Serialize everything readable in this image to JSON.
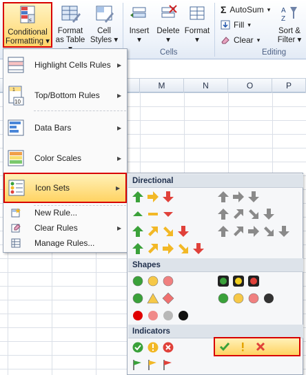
{
  "ribbon": {
    "conditional_formatting": {
      "line1": "Conditional",
      "line2": "Formatting"
    },
    "format_as_table": {
      "line1": "Format",
      "line2": "as Table"
    },
    "cell_styles": {
      "line1": "Cell",
      "line2": "Styles"
    },
    "insert": "Insert",
    "delete": "Delete",
    "format": "Format",
    "cells_group": "Cells",
    "autosum": "AutoSum",
    "fill": "Fill",
    "clear": "Clear",
    "sort_filter": {
      "line1": "Sort &",
      "line2": "Filter"
    },
    "editing_group": "Editing"
  },
  "columns": [
    "M",
    "N",
    "O",
    "P"
  ],
  "menu": {
    "items": [
      {
        "label": "Highlight Cells Rules",
        "icon": "highlight-cells-icon"
      },
      {
        "label": "Top/Bottom Rules",
        "icon": "top-bottom-icon"
      },
      {
        "label": "Data Bars",
        "icon": "data-bars-icon"
      },
      {
        "label": "Color Scales",
        "icon": "color-scales-icon"
      },
      {
        "label": "Icon Sets",
        "icon": "icon-sets-icon"
      }
    ],
    "new_rule": "New Rule...",
    "clear_rules": "Clear Rules",
    "manage_rules": "Manage Rules..."
  },
  "submenu": {
    "directional": "Directional",
    "shapes": "Shapes",
    "indicators": "Indicators"
  },
  "colors": {
    "highlight_border": "#d80000",
    "highlight_fill": "#ffd362",
    "green": "#3aa13a",
    "yellow": "#f2b826",
    "red": "#e0413a",
    "gray": "#8a8a8a"
  }
}
